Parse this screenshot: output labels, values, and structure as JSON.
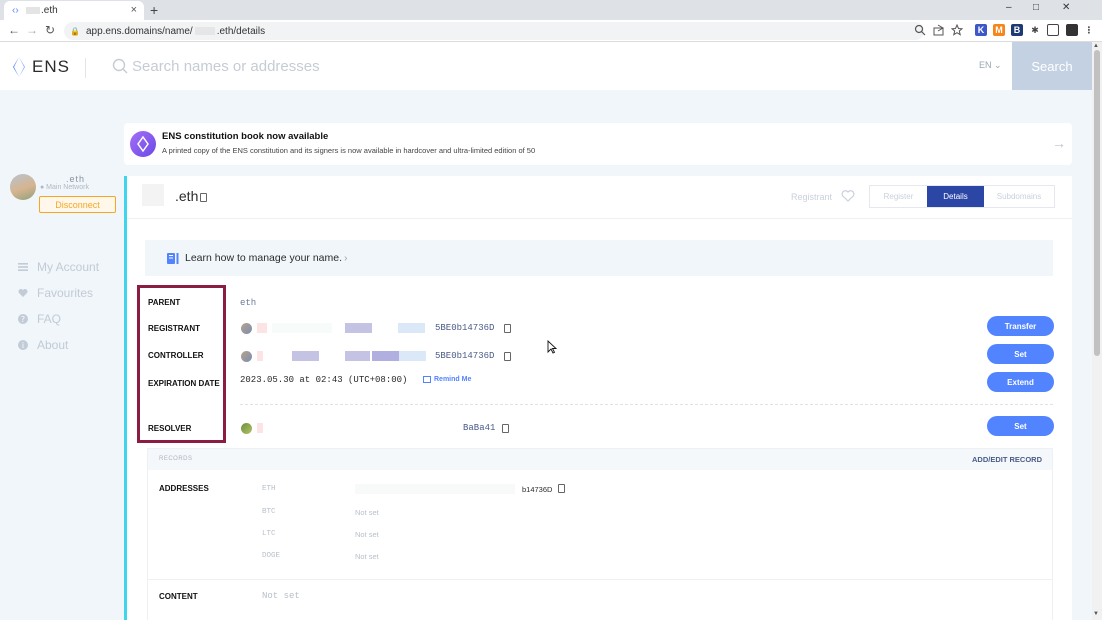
{
  "browser": {
    "tab_title": ".eth",
    "new_tab": "+",
    "close": "×",
    "url_prefix": "app.ens.domains/name/",
    "url_suffix": ".eth/details",
    "window_controls": [
      "–",
      "□",
      "✕"
    ]
  },
  "header": {
    "logo": "ENS",
    "search_placeholder": "Search names or addresses",
    "language": "EN",
    "search_button": "Search"
  },
  "sidebar": {
    "account_name": ".eth",
    "network": "● Main Network",
    "disconnect": "Disconnect",
    "items": [
      {
        "label": "My Account",
        "icon": "menu-icon"
      },
      {
        "label": "Favourites",
        "icon": "heart-icon"
      },
      {
        "label": "FAQ",
        "icon": "question-icon"
      },
      {
        "label": "About",
        "icon": "info-icon"
      }
    ]
  },
  "announcement": {
    "title": "ENS constitution book now available",
    "text": "A printed copy of the ENS constitution and its signers is now available in hardcover and ultra-limited edition of 50",
    "arrow": "→"
  },
  "name_card": {
    "name": ".eth",
    "registrant_label": "Registrant",
    "tabs": {
      "register": "Register",
      "details": "Details",
      "subdomains": "Subdomains"
    },
    "learn": "Learn how to manage your name.",
    "learn_chevron": "›"
  },
  "details": {
    "parent_label": "PARENT",
    "parent_value": "eth",
    "registrant_label": "REGISTRANT",
    "registrant_addr": "5BE0b14736D",
    "controller_label": "CONTROLLER",
    "controller_addr": "5BE0b14736D",
    "expiration_label": "EXPIRATION DATE",
    "expiration_value": "2023.05.30 at 02:43 (UTC+08:00)",
    "remind_me": "Remind Me",
    "resolver_label": "RESOLVER",
    "resolver_addr": "BaBa41",
    "buttons": {
      "transfer": "Transfer",
      "set": "Set",
      "extend": "Extend",
      "resolver_set": "Set"
    }
  },
  "records": {
    "label": "RECORDS",
    "add_edit": "ADD/EDIT RECORD",
    "addresses_label": "ADDRESSES",
    "eth": {
      "coin": "ETH",
      "value": "b14736D"
    },
    "btc": {
      "coin": "BTC",
      "value": "Not set"
    },
    "ltc": {
      "coin": "LTC",
      "value": "Not set"
    },
    "doge": {
      "coin": "DOGE",
      "value": "Not set"
    },
    "content_label": "CONTENT",
    "content_value": "Not set"
  },
  "colors": {
    "accent_blue": "#5284ff",
    "details_tab": "#2c46a6",
    "highlight_box": "#8b1c42",
    "card_border": "#3ed6ec",
    "disconnect": "#f5a623"
  }
}
